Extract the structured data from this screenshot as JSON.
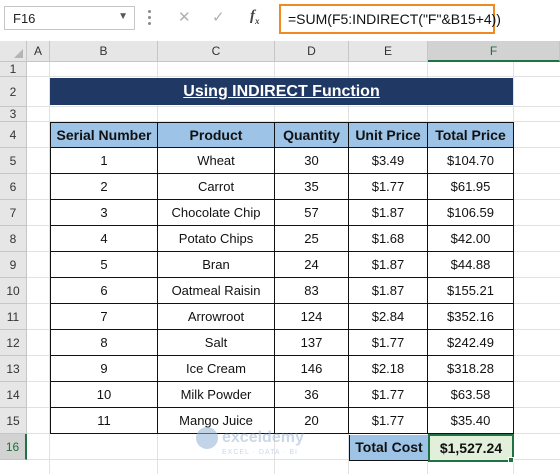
{
  "formula_bar": {
    "name_box": "F16",
    "formula": "=SUM(F5:INDIRECT(\"F\"&B15+4))",
    "icons": [
      "cancel-icon",
      "enter-icon",
      "function-icon"
    ]
  },
  "columns": [
    "A",
    "B",
    "C",
    "D",
    "E",
    "F"
  ],
  "rows": [
    "1",
    "2",
    "3",
    "4",
    "5",
    "6",
    "7",
    "8",
    "9",
    "10",
    "11",
    "12",
    "13",
    "14",
    "15",
    "16"
  ],
  "selected_cell": "F16",
  "title": "Using INDIRECT Function",
  "table": {
    "headers": [
      "Serial Number",
      "Product",
      "Quantity",
      "Unit Price",
      "Total Price"
    ],
    "rows": [
      [
        "1",
        "Wheat",
        "30",
        "$3.49",
        "$104.70"
      ],
      [
        "2",
        "Carrot",
        "35",
        "$1.77",
        "$61.95"
      ],
      [
        "3",
        "Chocolate Chip",
        "57",
        "$1.87",
        "$106.59"
      ],
      [
        "4",
        "Potato Chips",
        "25",
        "$1.68",
        "$42.00"
      ],
      [
        "5",
        "Bran",
        "24",
        "$1.87",
        "$44.88"
      ],
      [
        "6",
        "Oatmeal Raisin",
        "83",
        "$1.87",
        "$155.21"
      ],
      [
        "7",
        "Arrowroot",
        "124",
        "$2.84",
        "$352.16"
      ],
      [
        "8",
        "Salt",
        "137",
        "$1.77",
        "$242.49"
      ],
      [
        "9",
        "Ice Cream",
        "146",
        "$2.18",
        "$318.28"
      ],
      [
        "10",
        "Milk Powder",
        "36",
        "$1.77",
        "$63.58"
      ],
      [
        "11",
        "Mango Juice",
        "20",
        "$1.77",
        "$35.40"
      ]
    ],
    "total_label": "Total Cost",
    "total_value": "$1,527.24"
  },
  "watermark": {
    "name": "exceldemy",
    "tagline": "EXCEL · DATA · BI"
  },
  "colors": {
    "title_bg": "#203864",
    "header_bg": "#9dc3e6",
    "selection": "#1f7244",
    "formula_border": "#ee8a1f"
  }
}
